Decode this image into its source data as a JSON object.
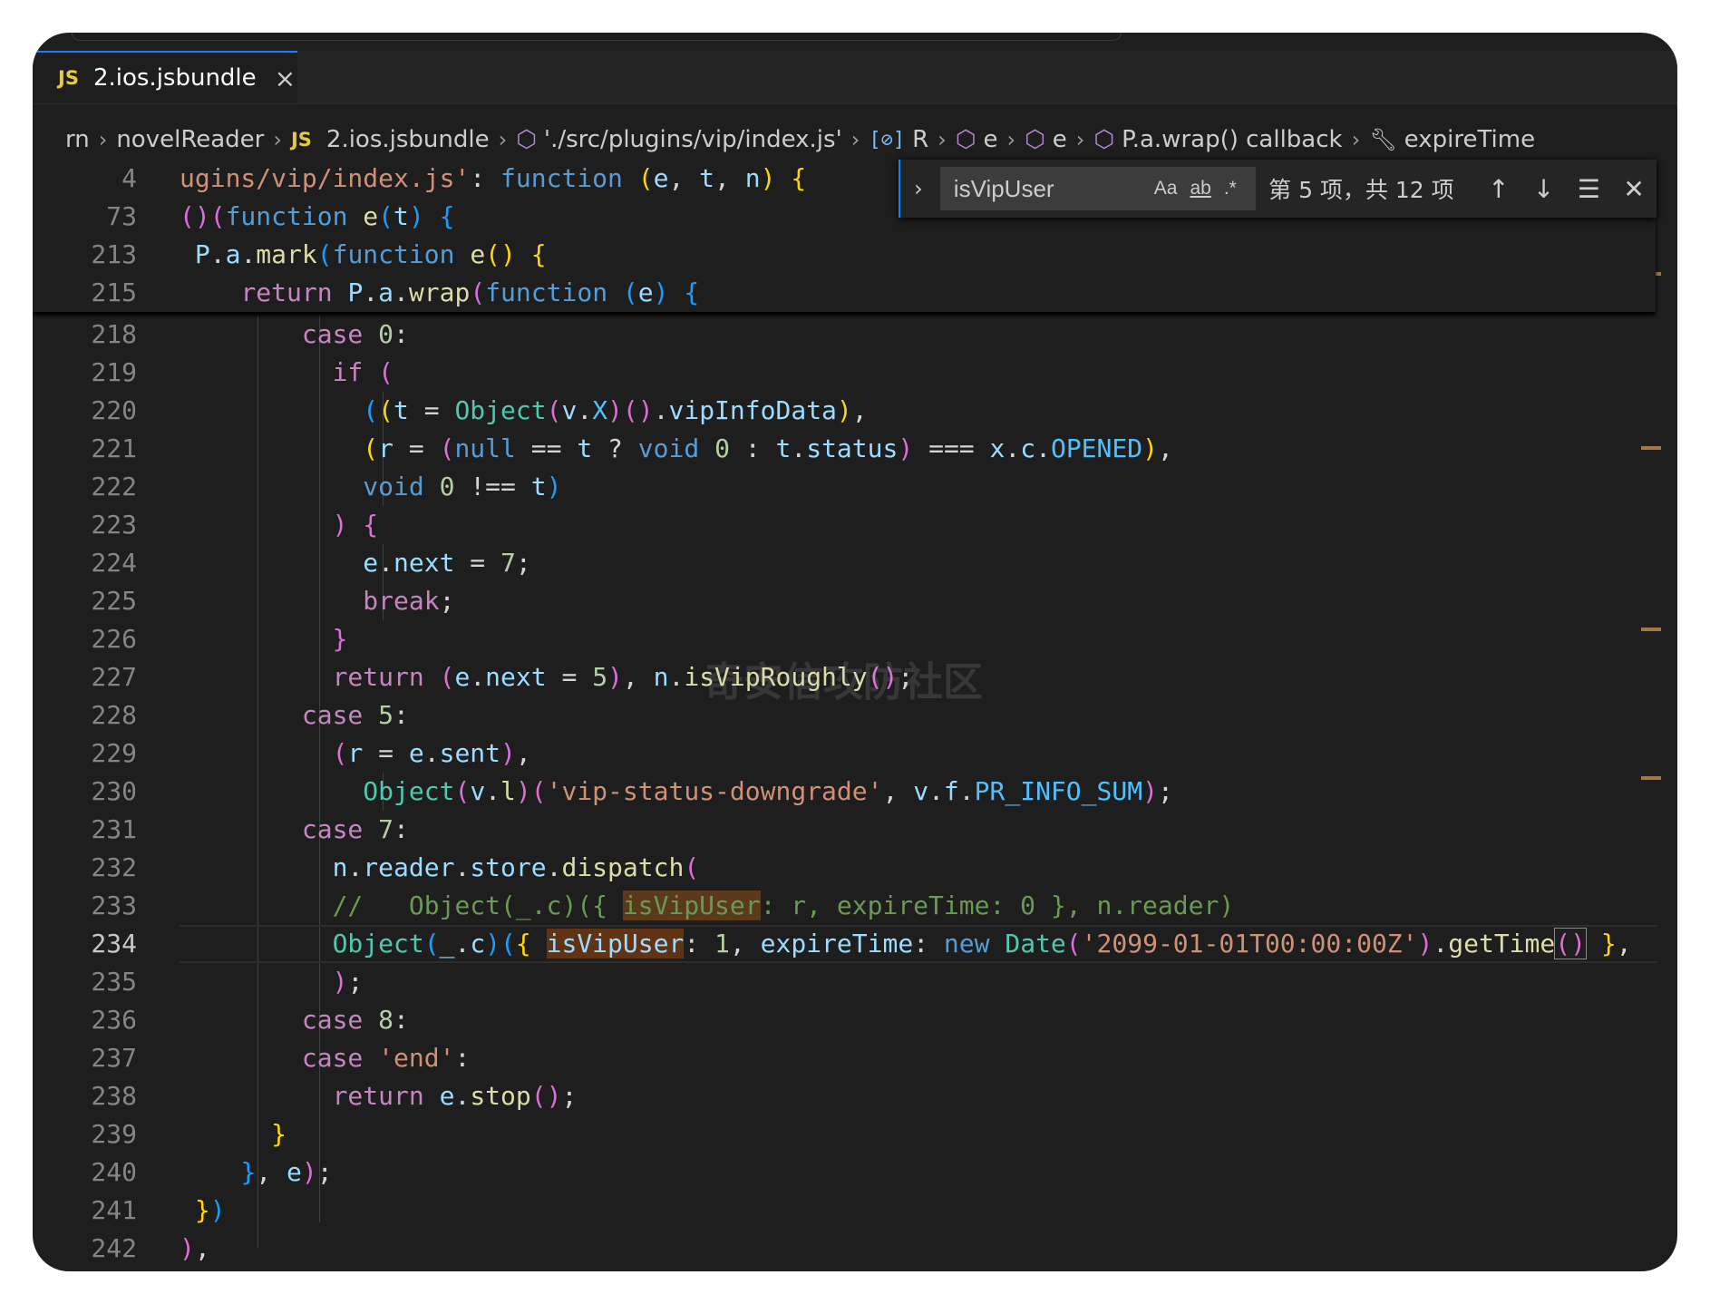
{
  "tab": {
    "icon_label": "JS",
    "file": "2.ios.jsbundle",
    "close": "×"
  },
  "breadcrumb": {
    "items": [
      {
        "text": "rn"
      },
      {
        "text": "novelReader"
      },
      {
        "icon": "JS",
        "text": "2.ios.jsbundle"
      },
      {
        "text": "'./src/plugins/vip/index.js'"
      },
      {
        "text": "R"
      },
      {
        "text": "e"
      },
      {
        "text": "e"
      },
      {
        "text": "P.a.wrap() callback"
      },
      {
        "text": "expireTime"
      }
    ]
  },
  "find": {
    "query": "isVipUser",
    "match_case": "Aa",
    "whole_word": "ab",
    "regex": ".*",
    "result": "第 5 项，共 12 项"
  },
  "sticky_line_numbers": [
    "4",
    "73",
    "213",
    "215"
  ],
  "line_numbers": [
    "218",
    "219",
    "220",
    "221",
    "222",
    "223",
    "224",
    "225",
    "226",
    "227",
    "228",
    "229",
    "230",
    "231",
    "232",
    "233",
    "234",
    "235",
    "236",
    "237",
    "238",
    "239",
    "240",
    "241",
    "242"
  ],
  "active_line": "234",
  "watermark": "奇安信攻防社区"
}
